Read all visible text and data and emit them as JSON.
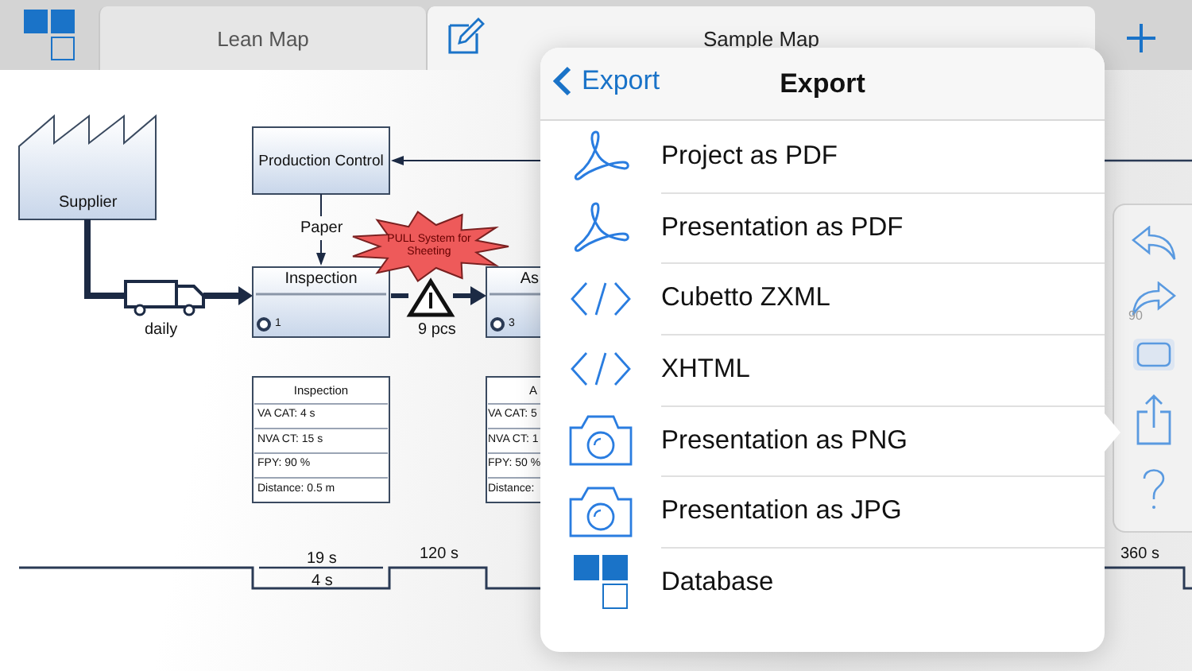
{
  "tabs": [
    {
      "label": "Lean Map",
      "selected": false
    },
    {
      "label": "Sample Map",
      "selected": true
    }
  ],
  "canvas": {
    "supplier": {
      "label": "Supplier"
    },
    "control": {
      "label": "Production Control"
    },
    "info_flow": {
      "label": "Paper"
    },
    "transport": {
      "label": "daily"
    },
    "processes": [
      {
        "title": "Inspection",
        "operators": "1"
      },
      {
        "title": "As",
        "operators": "3"
      }
    ],
    "kaizen_burst": {
      "label": "PULL System for Sheeting"
    },
    "inventory": {
      "label": "9 pcs"
    },
    "faded_inventory": {
      "label": "90"
    },
    "data_boxes": [
      {
        "title": "Inspection",
        "rows": [
          "VA CAT: 4 s",
          "NVA CT: 15 s",
          "FPY: 90 %",
          "Distance: 0.5 m"
        ]
      },
      {
        "title": "A",
        "rows": [
          "VA CAT: 5",
          "NVA CT: 1",
          "FPY: 50 %",
          "Distance:"
        ]
      }
    ],
    "timeline": {
      "process_time": "19 s",
      "value_time": "4 s",
      "wait_time": "120 s",
      "lead_time": "360 s"
    }
  },
  "popover": {
    "back": "Export",
    "title": "Export",
    "items": [
      {
        "label": "Project as PDF",
        "kind": "pdf"
      },
      {
        "label": "Presentation as PDF",
        "kind": "pdf"
      },
      {
        "label": "Cubetto ZXML",
        "kind": "code"
      },
      {
        "label": "XHTML",
        "kind": "code"
      },
      {
        "label": "Presentation as PNG",
        "kind": "camera"
      },
      {
        "label": "Presentation as JPG",
        "kind": "camera"
      },
      {
        "label": "Database",
        "kind": "database"
      }
    ]
  }
}
